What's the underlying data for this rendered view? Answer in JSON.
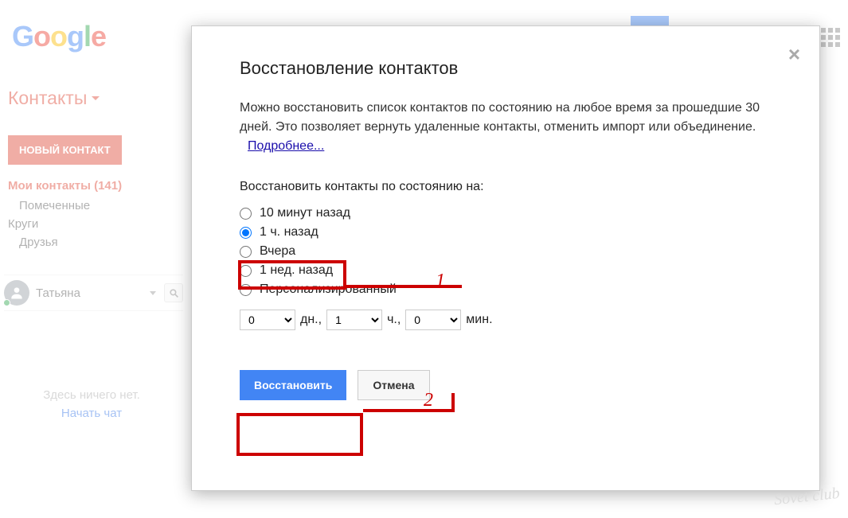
{
  "logo": "Google",
  "app_title": "Контакты",
  "new_contact": "НОВЫЙ КОНТАКТ",
  "sidebar": {
    "my_contacts": "Мои контакты (141)",
    "starred": "Помеченные",
    "circles": "Круги",
    "friends": "Друзья"
  },
  "user": "Татьяна",
  "chat": {
    "empty": "Здесь ничего нет.",
    "start": "Начать чат"
  },
  "dialog": {
    "title": "Восстановление контактов",
    "desc": "Можно восстановить список контактов по состоянию на любое время за прошедшие 30 дней. Это позволяет вернуть удаленные контакты, отменить импорт или объединение.",
    "learn_more": "Подробнее...",
    "restore_to": "Восстановить контакты по состоянию на:",
    "opt1": "10 минут назад",
    "opt2": "1 ч. назад",
    "opt3": "Вчера",
    "opt4": "1 нед. назад",
    "opt5": "Персонализированный",
    "days_val": "0",
    "hours_val": "1",
    "mins_val": "0",
    "days_lbl": "дн.,",
    "hours_lbl": "ч.,",
    "mins_lbl": "мин.",
    "restore_btn": "Восстановить",
    "cancel_btn": "Отмена"
  },
  "annotation": {
    "n1": "1",
    "n2": "2"
  },
  "watermark": "Sovet club"
}
